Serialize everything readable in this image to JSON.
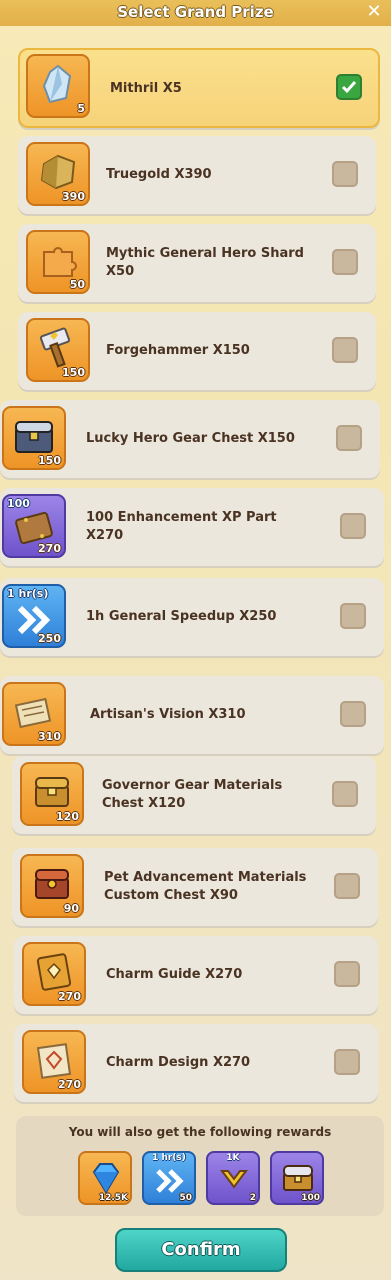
{
  "header": {
    "title": "Select Grand Prize",
    "close_icon": "close-icon"
  },
  "items": [
    {
      "label": "Mithril X5",
      "qty": "5",
      "selected": true,
      "icon": "mithril-crystal-icon"
    },
    {
      "label": "Truegold X390",
      "qty": "390",
      "selected": false,
      "icon": "truegold-ore-icon"
    },
    {
      "label": "Mythic General Hero Shard X50",
      "qty": "50",
      "selected": false,
      "icon": "hero-shard-icon"
    },
    {
      "label": "Forgehammer X150",
      "qty": "150",
      "selected": false,
      "icon": "forgehammer-icon"
    },
    {
      "label": "Lucky Hero Gear Chest X150",
      "qty": "150",
      "selected": false,
      "icon": "gear-chest-icon"
    },
    {
      "label": "100 Enhancement XP Part X270",
      "qty": "270",
      "tag": "100",
      "selected": false,
      "icon": "xp-part-icon"
    },
    {
      "label": "1h General Speedup X250",
      "qty": "250",
      "tag": "1 hr(s)",
      "selected": false,
      "icon": "speedup-icon"
    },
    {
      "label": "Artisan's Vision X310",
      "qty": "310",
      "selected": false,
      "icon": "scroll-map-icon"
    },
    {
      "label": "Governor Gear Materials Chest X120",
      "qty": "120",
      "selected": false,
      "icon": "materials-chest-icon"
    },
    {
      "label": "Pet Advancement Materials Custom Chest X90",
      "qty": "90",
      "selected": false,
      "icon": "pet-chest-icon"
    },
    {
      "label": "Charm Guide X270",
      "qty": "270",
      "selected": false,
      "icon": "charm-guide-book-icon"
    },
    {
      "label": "Charm Design X270",
      "qty": "270",
      "selected": false,
      "icon": "charm-design-scroll-icon"
    }
  ],
  "rewards": {
    "title": "You will also get the following rewards",
    "list": [
      {
        "icon": "gem-icon",
        "qty": "12.5K"
      },
      {
        "icon": "speedup-icon",
        "qty": "50",
        "tag": "1 hr(s)"
      },
      {
        "icon": "chevron-badge-icon",
        "qty": "2",
        "tag": "1K"
      },
      {
        "icon": "treasure-chest-icon",
        "qty": "100"
      }
    ]
  },
  "confirm_label": "Confirm",
  "colors": {
    "selected_bg": "#f6d37a",
    "item_bg": "#ece7dd",
    "orange_frame": "#ee9427",
    "blue_frame": "#2e80d8",
    "purple_frame": "#6e53cc",
    "check_green": "#3aa63f",
    "confirm_teal": "#21a8a0"
  }
}
